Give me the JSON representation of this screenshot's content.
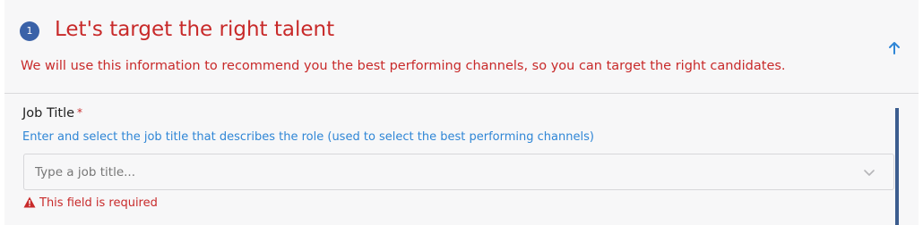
{
  "section": {
    "step_number": "1",
    "title": "Let's target the right talent",
    "subtitle": "We will use this information to recommend you the best performing channels, so you can target the right candidates.",
    "collapse_icon": "arrow-up-icon",
    "accent_color": "#c82a2a",
    "badge_color": "#3a62a8"
  },
  "job_title_field": {
    "label": "Job Title",
    "required_marker": "*",
    "helper_text": "Enter and select the job title that describes the role (used to select the best performing channels)",
    "placeholder": "Type a job title...",
    "value": "",
    "dropdown_icon": "chevron-down-icon",
    "error_icon": "warning-icon",
    "error_text": "This field is required",
    "helper_color": "#2f86d6"
  }
}
